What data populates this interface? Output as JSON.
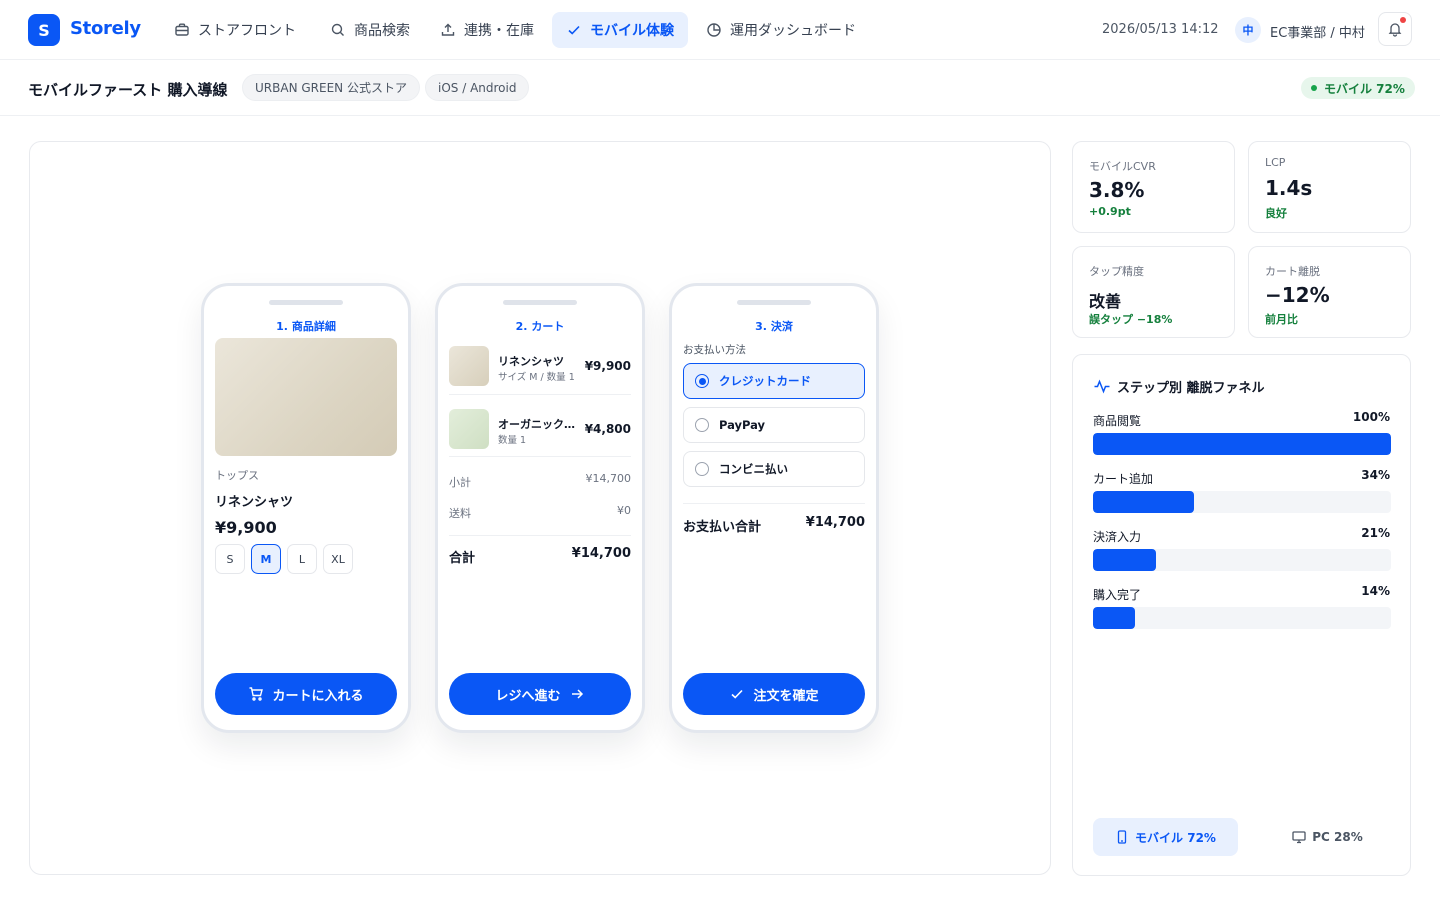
{
  "app": {
    "logo_letter": "S",
    "name": "Storely"
  },
  "nav": [
    {
      "label": "ストアフロント",
      "icon": "storefront-icon"
    },
    {
      "label": "商品検索",
      "icon": "search-icon"
    },
    {
      "label": "連携・在庫",
      "icon": "upload-icon"
    },
    {
      "label": "モバイル体験",
      "icon": "check-icon",
      "active": true
    },
    {
      "label": "運用ダッシュボード",
      "icon": "pie-chart-icon"
    }
  ],
  "header": {
    "datetime": "2026/05/13 14:12",
    "user_initial": "中",
    "user_name": "EC事業部 / 中村"
  },
  "subheader": {
    "title": "モバイルファースト 購入導線",
    "chips": [
      "URBAN GREEN 公式ストア",
      "iOS / Android"
    ],
    "badge": "モバイル 72%"
  },
  "phones": {
    "product": {
      "step": "1. 商品詳細",
      "category": "トップス",
      "name": "リネンシャツ",
      "price": "¥9,900",
      "sizes": [
        "S",
        "M",
        "L",
        "XL"
      ],
      "selected_size": "M",
      "cta": "カートに入れる"
    },
    "cart": {
      "step": "2. カート",
      "items": [
        {
          "name": "リネンシャツ",
          "sub": "サイズ M / 数量 1",
          "price": "¥9,900"
        },
        {
          "name": "オーガニックコットンT",
          "sub": "数量 1",
          "price": "¥4,800"
        }
      ],
      "subtotal_label": "小計",
      "subtotal": "¥14,700",
      "shipping_label": "送料",
      "shipping": "¥0",
      "total_label": "合計",
      "total": "¥14,700",
      "cta": "レジへ進む"
    },
    "checkout": {
      "step": "3. 決済",
      "method_label": "お支払い方法",
      "methods": [
        "クレジットカード",
        "PayPay",
        "コンビニ払い"
      ],
      "selected_method": "クレジットカード",
      "total_label": "お支払い合計",
      "total": "¥14,700",
      "cta": "注文を確定"
    }
  },
  "kpis": [
    {
      "label": "モバイルCVR",
      "value": "3.8%",
      "sub": "+0.9pt"
    },
    {
      "label": "LCP",
      "value": "1.4s",
      "sub": "良好"
    },
    {
      "label": "タップ精度",
      "value": "改善",
      "sub": "誤タップ −18%"
    },
    {
      "label": "カート離脱",
      "value": "−12%",
      "sub": "前月比"
    }
  ],
  "funnel": {
    "title": "ステップ別 離脱ファネル",
    "steps": [
      {
        "name": "商品閲覧",
        "pct_label": "100%",
        "value": 100
      },
      {
        "name": "カート追加",
        "pct_label": "34%",
        "value": 34
      },
      {
        "name": "決済入力",
        "pct_label": "21%",
        "value": 21
      },
      {
        "name": "購入完了",
        "pct_label": "14%",
        "value": 14
      }
    ],
    "toggle": [
      {
        "label": "モバイル 72%",
        "icon": "smartphone-icon",
        "active": true
      },
      {
        "label": "PC 28%",
        "icon": "monitor-icon",
        "active": false
      }
    ]
  },
  "colors": {
    "accent": "#0a57f5",
    "positive": "#15803d",
    "accent_light": "#e8f0fe"
  }
}
